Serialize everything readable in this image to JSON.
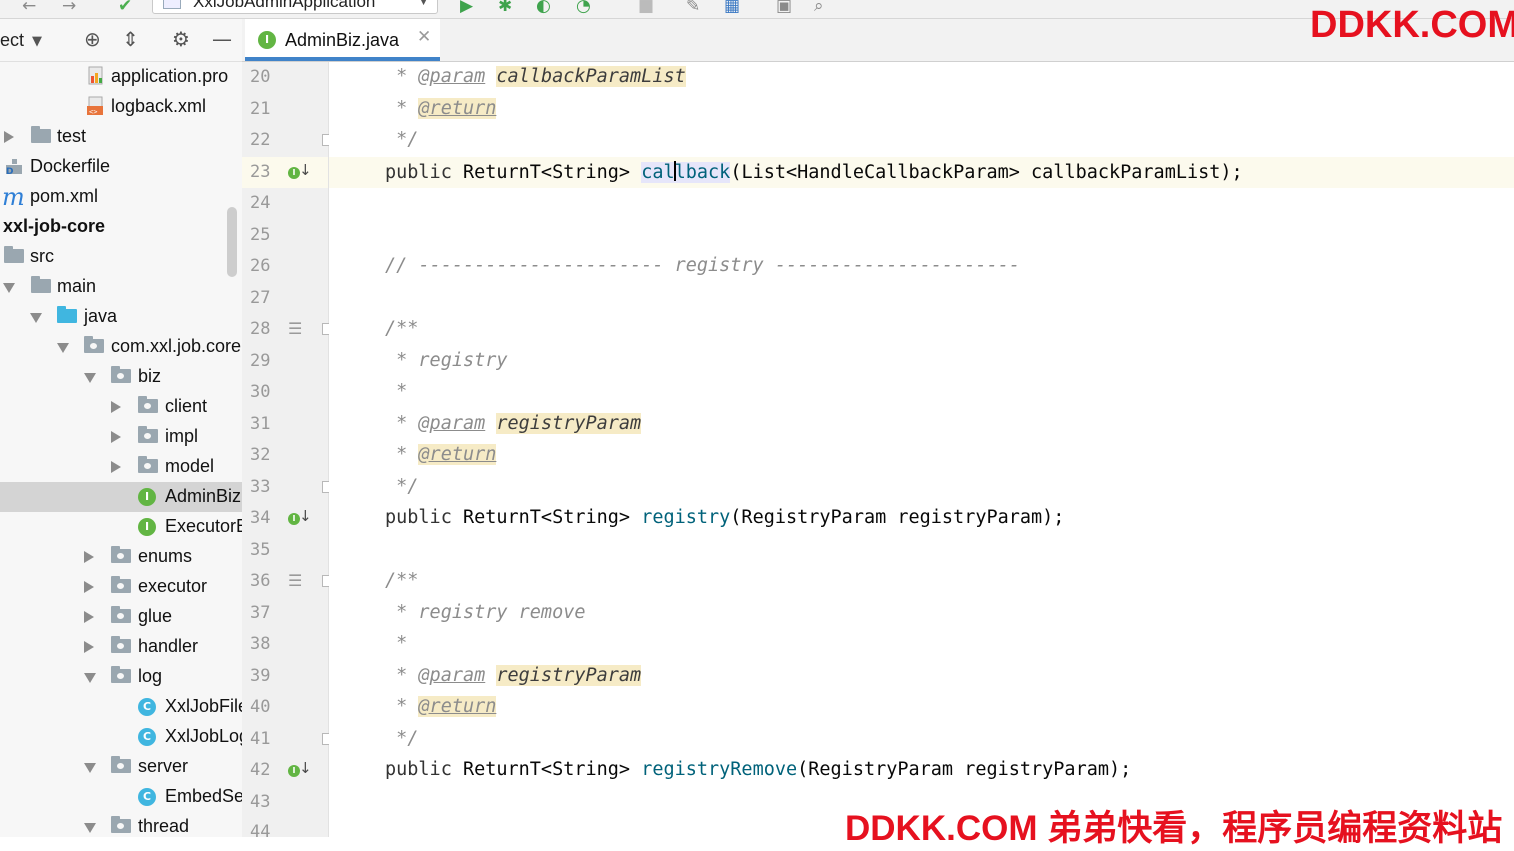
{
  "toolbar": {
    "run_config": "XxlJobAdminApplication"
  },
  "project_panel": {
    "title": "ect",
    "tree": [
      {
        "label": "application.pro",
        "kind": "properties-file"
      },
      {
        "label": "logback.xml",
        "kind": "xml-file"
      },
      {
        "label": "test",
        "kind": "folder"
      },
      {
        "label": "Dockerfile",
        "kind": "docker-file"
      },
      {
        "label": "pom.xml",
        "kind": "maven-file"
      },
      {
        "label": "xxl-job-core",
        "kind": "module"
      },
      {
        "label": "src",
        "kind": "folder"
      },
      {
        "label": "main",
        "kind": "folder"
      },
      {
        "label": "java",
        "kind": "source-folder"
      },
      {
        "label": "com.xxl.job.core",
        "kind": "package"
      },
      {
        "label": "biz",
        "kind": "package"
      },
      {
        "label": "client",
        "kind": "package"
      },
      {
        "label": "impl",
        "kind": "package"
      },
      {
        "label": "model",
        "kind": "package"
      },
      {
        "label": "AdminBiz",
        "kind": "interface",
        "selected": true
      },
      {
        "label": "ExecutorBiz",
        "kind": "interface"
      },
      {
        "label": "enums",
        "kind": "package"
      },
      {
        "label": "executor",
        "kind": "package"
      },
      {
        "label": "glue",
        "kind": "package"
      },
      {
        "label": "handler",
        "kind": "package"
      },
      {
        "label": "log",
        "kind": "package"
      },
      {
        "label": "XxlJobFileAppender",
        "kind": "class"
      },
      {
        "label": "XxlJobLogger",
        "kind": "class"
      },
      {
        "label": "server",
        "kind": "package"
      },
      {
        "label": "EmbedServer",
        "kind": "class"
      },
      {
        "label": "thread",
        "kind": "package"
      }
    ]
  },
  "editor": {
    "tab_label": "AdminBiz.java",
    "line_numbers": [
      "20",
      "21",
      "22",
      "23",
      "24",
      "25",
      "26",
      "27",
      "28",
      "29",
      "30",
      "31",
      "32",
      "33",
      "34",
      "35",
      "36",
      "37",
      "38",
      "39",
      "40",
      "41",
      "42",
      "43",
      "44"
    ],
    "code": {
      "l20_star": " * ",
      "l20_tag": "@param",
      "l20_val": "callbackParamList",
      "l21_star": " * ",
      "l21_tag": "@return",
      "l22": " */",
      "l23_kw": "public",
      "l23_type": "ReturnT<String>",
      "l23_m1": "cal",
      "l23_m2": "lback",
      "l23_rest": "(List<HandleCallbackParam> callbackParamList);",
      "l26": "// ---------------------- registry ----------------------",
      "l28": "/**",
      "l29": " * registry",
      "l30": " *",
      "l31_star": " * ",
      "l31_tag": "@param",
      "l31_val": "registryParam",
      "l32_star": " * ",
      "l32_tag": "@return",
      "l33": " */",
      "l34_kw": "public",
      "l34_type": "ReturnT<String>",
      "l34_m": "registry",
      "l34_rest": "(RegistryParam registryParam);",
      "l36": "/**",
      "l37": " * registry remove",
      "l38": " *",
      "l39_star": " * ",
      "l39_tag": "@param",
      "l39_val": "registryParam",
      "l40_star": " * ",
      "l40_tag": "@return",
      "l41": " */",
      "l42_kw": "public",
      "l42_type": "ReturnT<String>",
      "l42_m": "registryRemove",
      "l42_rest": "(RegistryParam registryParam);"
    }
  },
  "watermarks": {
    "top": "DDKK.COM",
    "bottom": "DDKK.COM 弟弟快看，程序员编程资料站"
  },
  "colors": {
    "accent_tab": "#4083c9",
    "interface_icon": "#62b543",
    "class_icon": "#40b6e0",
    "watermark": "#e6111f"
  }
}
